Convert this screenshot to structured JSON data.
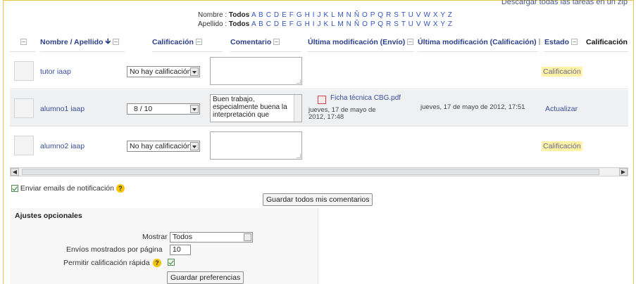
{
  "header": {
    "download_all": "Descargar todas las tareas en un zip",
    "first_name_label": "Nombre :",
    "last_name_label": "Apellido :",
    "all_label": "Todos",
    "letters": "A B C D E F G H I J K L M N Ñ O P Q R S T U V W X Y Z"
  },
  "table": {
    "columns": [
      "Nombre / Apellido",
      "Calificación",
      "Comentario",
      "Última modificación (Envío)",
      "Última modificación (Calificación)",
      "Estado",
      "Calificación"
    ],
    "rows": [
      {
        "name": "tutor iaap",
        "grade": "No hay calificación",
        "comment": "",
        "file": "",
        "submitted": "",
        "graded": "",
        "status": "Calificación"
      },
      {
        "name": "alumno1 iaap",
        "grade": "8 / 10",
        "comment": "Buen trabajo, especialmente buena la interpretación que",
        "file": "Ficha técnica CBG.pdf",
        "submitted": "jueves, 17 de mayo de 2012, 17:48",
        "graded": "jueves, 17 de mayo de 2012, 17:51",
        "status": "Actualizar"
      },
      {
        "name": "alumno2 iaap",
        "grade": "No hay calificación",
        "comment": "",
        "file": "",
        "submitted": "",
        "graded": "",
        "status": "Calificación"
      }
    ]
  },
  "notify": {
    "label": "Enviar emails de notificación",
    "checked": true
  },
  "save_comments_button": "Guardar todos mis comentarios",
  "options": {
    "title": "Ajustes opcionales",
    "show_label": "Mostrar",
    "show_value": "Todos",
    "per_page_label": "Envíos mostrados por página",
    "per_page_value": "10",
    "quick_grade_label": "Permitir calificación rápida",
    "quick_grade_checked": true,
    "save_prefs_button": "Guardar preferencias"
  },
  "colors": {
    "link": "#3a4e9a",
    "header_text": "#2b3f8a",
    "status_highlight": "#fff3a8",
    "frame": "#e6c84a"
  }
}
